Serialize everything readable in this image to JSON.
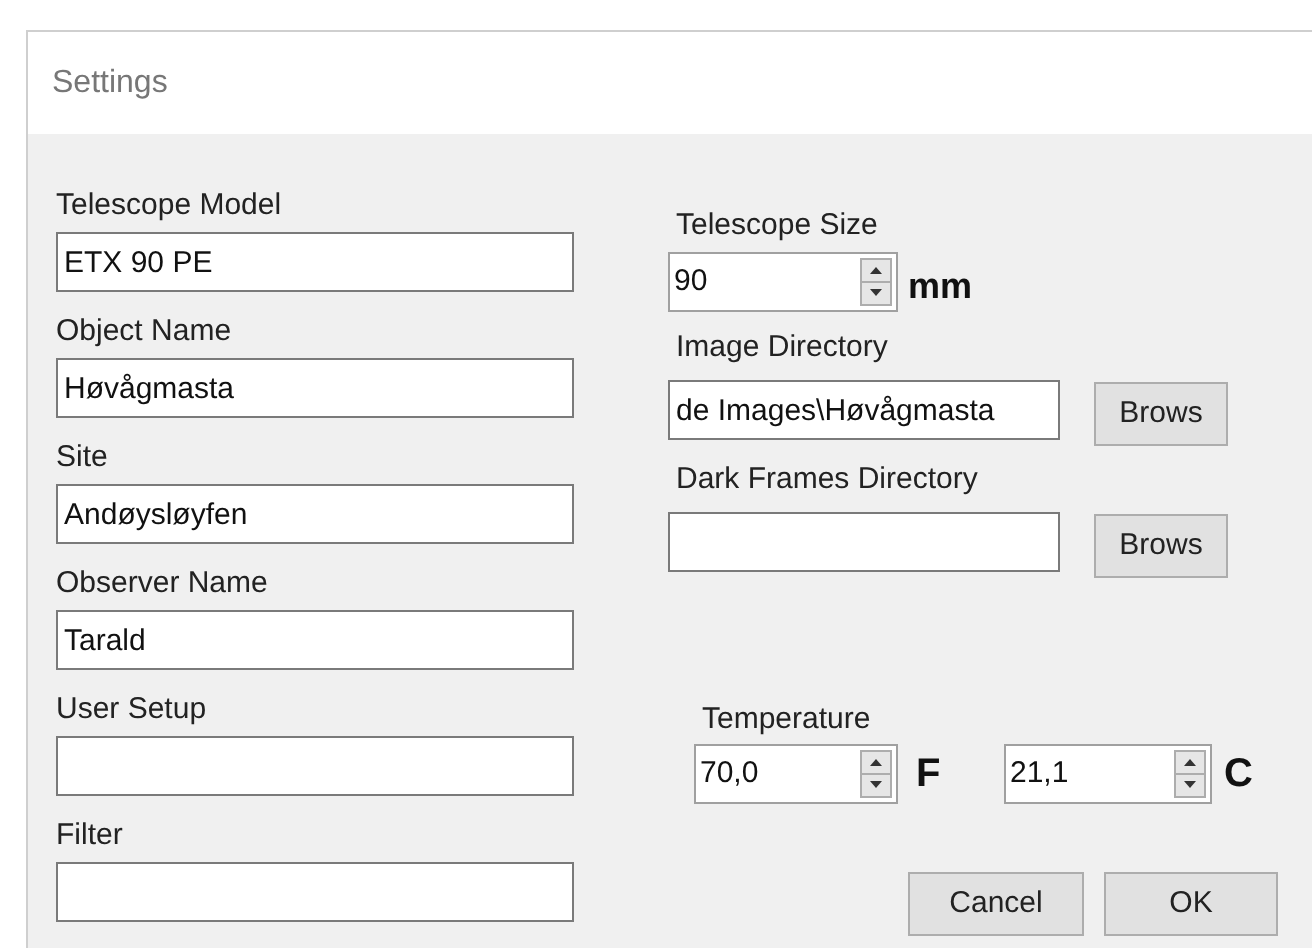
{
  "window": {
    "title": "Settings"
  },
  "left_fields": [
    {
      "label": "Telescope Model",
      "value": "ETX 90 PE"
    },
    {
      "label": "Object Name",
      "value": "Høvågmasta"
    },
    {
      "label": "Site",
      "value": "Andøysløyfen"
    },
    {
      "label": "Observer Name",
      "value": "Tarald"
    },
    {
      "label": "User Setup"
    },
    {
      "label": "Filter"
    }
  ],
  "telescope_size": {
    "label": "Telescope Size",
    "value": "90",
    "unit": "mm"
  },
  "directories": [
    {
      "label": "Image Directory",
      "value": "de Images\\Høvågmasta",
      "button": "Brows"
    },
    {
      "label": "Dark Frames Directory",
      "button": "Brows"
    }
  ],
  "temperature": {
    "label": "Temperature",
    "fahrenheit": {
      "value": "70,0",
      "unit": "F"
    },
    "celsius": {
      "value": "21,1",
      "unit": "C"
    }
  },
  "buttons": [
    "Cancel",
    "OK"
  ]
}
